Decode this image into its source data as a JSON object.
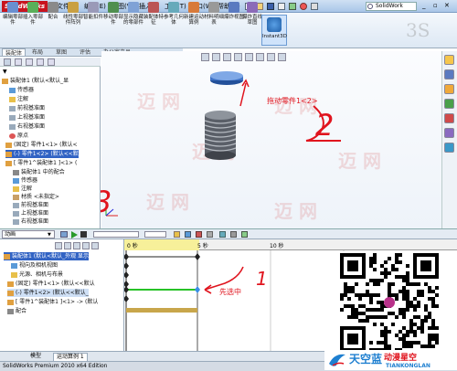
{
  "app": {
    "logo": "SolidWorks",
    "menus": [
      "文件(F)",
      "编辑(E)",
      "视图(V)",
      "插入(I)",
      "工具(T)",
      "窗口(W)",
      "帮助(H)"
    ],
    "search_placeholder": "SolidWork",
    "window_controls": [
      "_",
      "▫",
      "✕"
    ]
  },
  "ribbon": {
    "buttons": [
      "编辑零部件",
      "插入零部件",
      "配合",
      "线性零部件阵列",
      "智能扣件",
      "移动零部件",
      "显示隐藏的零部件",
      "装配体特征",
      "参考几何体",
      "新建运动算例",
      "材料明细表",
      "爆炸视图",
      "爆炸直线草图"
    ],
    "instant3d": "Instant3D"
  },
  "cm_tabs": [
    "装配体",
    "布局",
    "草图",
    "评估",
    "办公室产品"
  ],
  "feature_tree": {
    "items": [
      "装配体1 (默认<默认_显",
      "传感器",
      "注解",
      "前视基准面",
      "上视基准面",
      "右视基准面",
      "原点",
      "(固定) 零件1<1> (默认<",
      "(-) 零件1<2> (默认<<默",
      "[ 零件1^装配体1 ]<1> (",
      "装配体1 中的配合",
      "传感器",
      "注解",
      "材质 <未指定>",
      "前视基准面",
      "上视基准面",
      "右视基准面"
    ]
  },
  "motion": {
    "study_type": "动画",
    "tree": [
      "装配体1 (默认<默认_外观 显示",
      "视向及相机视图",
      "光源、相机与布景",
      "(固定) 零件1<1> (默认<<默认",
      "(-) 零件1<2> (默认<<默认_",
      "[ 零件1^装配体1 ]<1> -> (默认",
      "配合"
    ],
    "ruler_labels": [
      "0 秒",
      "5 秒",
      "10 秒"
    ]
  },
  "bottom_tabs": [
    "模型",
    "运动算例 1"
  ],
  "status": "SolidWorks Premium 2010 x64 Edition",
  "annotations": {
    "drag_text": "拖动零件1<2>",
    "select_text": "先选中",
    "num2": "2",
    "num3": "3",
    "num1": "1"
  },
  "watermark": {
    "brand_cn": "天空蓝",
    "brand_tag": "动漫星空",
    "brand_en": "TIANKONGLAN",
    "faint": "迈 网"
  },
  "colors": {
    "annotation_red": "#e0141e",
    "selection_blue": "#3163c4",
    "ruler_yellow": "#f7f09a",
    "track_green": "#27c227",
    "track_gold": "#c8a64b"
  }
}
